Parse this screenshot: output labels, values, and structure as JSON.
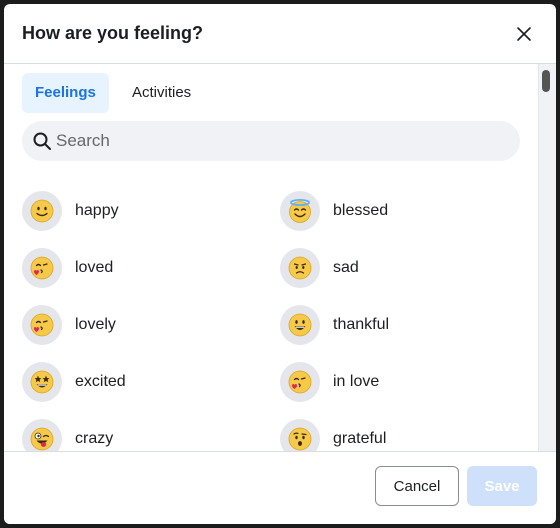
{
  "dialog": {
    "title": "How are you feeling?"
  },
  "tabs": [
    {
      "label": "Feelings",
      "active": true
    },
    {
      "label": "Activities",
      "active": false
    }
  ],
  "search": {
    "placeholder": "Search",
    "value": ""
  },
  "feelings": [
    {
      "label": "happy",
      "icon": "slightly-smiling-face-icon"
    },
    {
      "label": "blessed",
      "icon": "smiling-face-with-halo-icon"
    },
    {
      "label": "loved",
      "icon": "face-blowing-kiss-icon"
    },
    {
      "label": "sad",
      "icon": "worried-face-icon"
    },
    {
      "label": "lovely",
      "icon": "face-blowing-kiss-icon"
    },
    {
      "label": "thankful",
      "icon": "grinning-face-icon"
    },
    {
      "label": "excited",
      "icon": "star-struck-face-icon"
    },
    {
      "label": "in love",
      "icon": "face-blowing-kiss-icon"
    },
    {
      "label": "crazy",
      "icon": "winking-tongue-face-icon"
    },
    {
      "label": "grateful",
      "icon": "face-with-raised-eyebrow-icon"
    }
  ],
  "footer": {
    "cancel_label": "Cancel",
    "save_label": "Save"
  },
  "colors": {
    "accent": "#1b74e4",
    "tab_active_bg": "#e7f3ff",
    "save_disabled_bg": "#cfe0fa",
    "emoji_yellow": "#f7c948"
  }
}
